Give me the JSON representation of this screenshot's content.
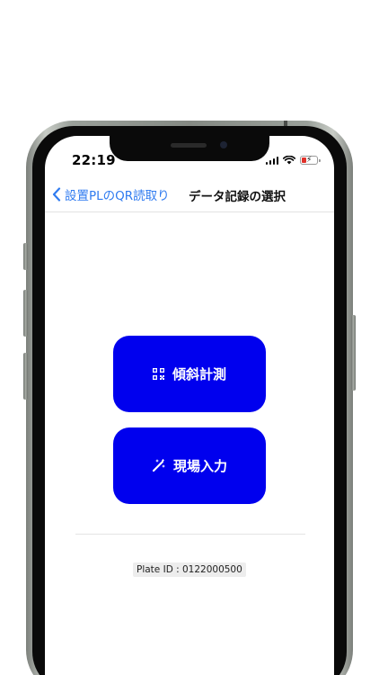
{
  "status_bar": {
    "time": "22:19",
    "icons": [
      "cellular-signal-icon",
      "wifi-icon",
      "battery-charging-icon"
    ],
    "battery_color": "#e0312a"
  },
  "nav": {
    "back_label": "設置PLのQR読取り",
    "back_icon": "chevron-left-icon",
    "title": "データ記録の選択",
    "accent_color": "#2f7bf0"
  },
  "actions": {
    "button_color": "#0000ee",
    "tilt": {
      "label": "傾斜計測",
      "icon": "qr-code-icon"
    },
    "field": {
      "label": "現場入力",
      "icon": "magic-wand-icon"
    }
  },
  "plate": {
    "label": "Plate ID : 0122000500"
  }
}
